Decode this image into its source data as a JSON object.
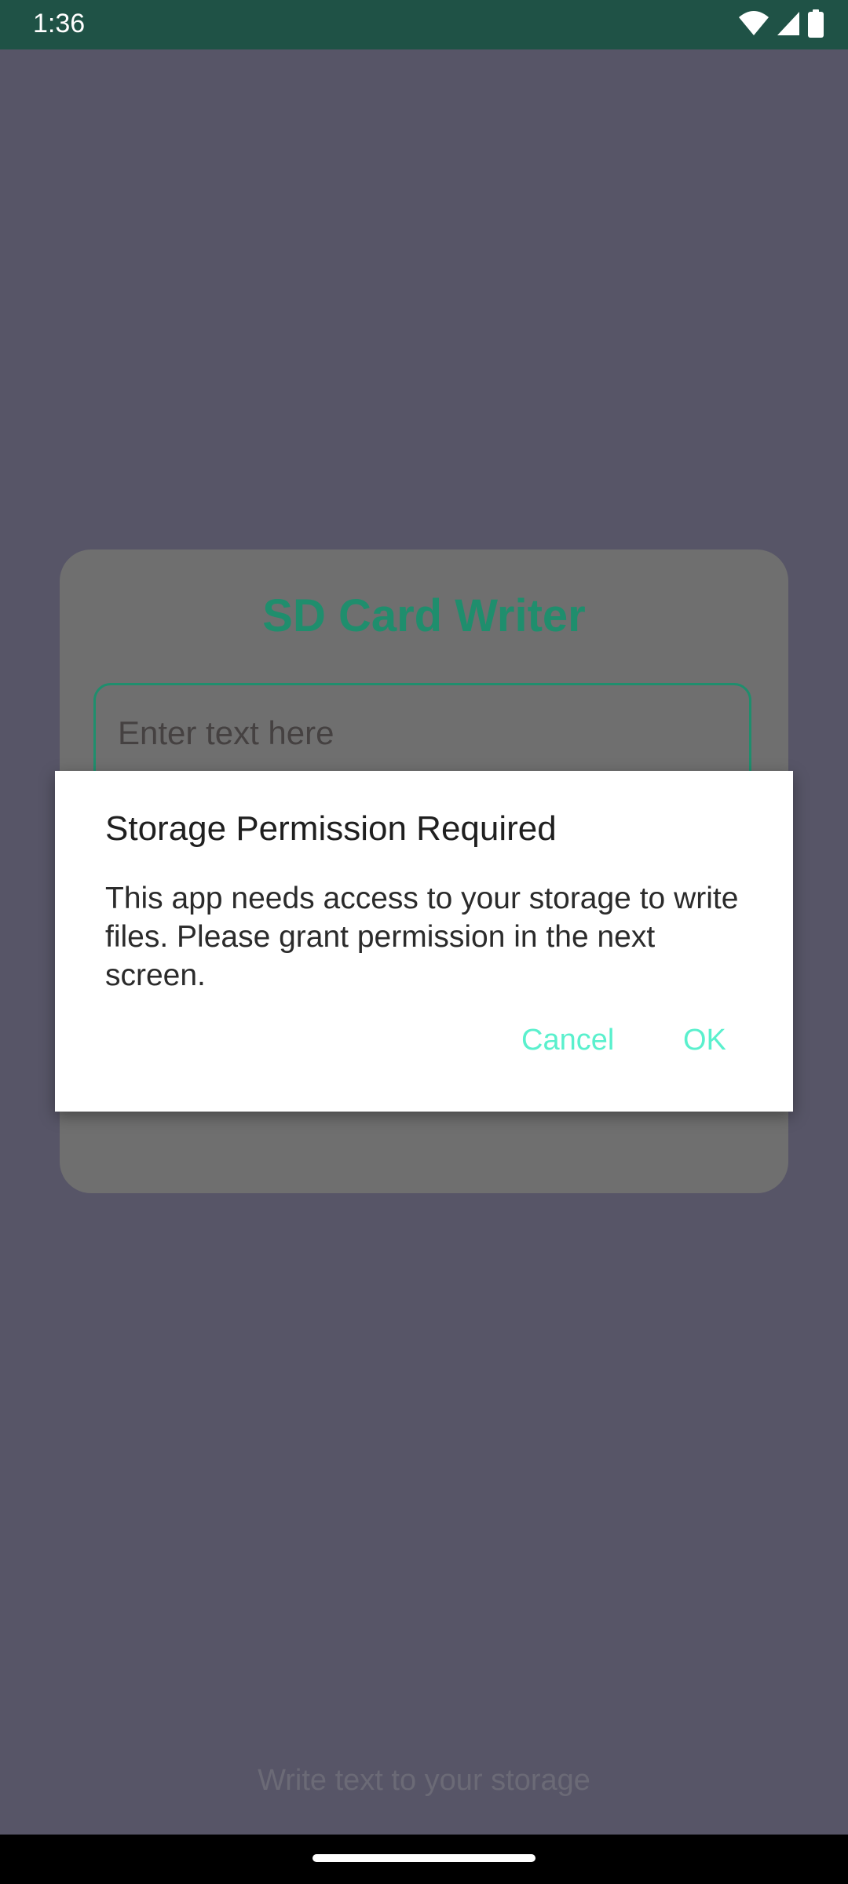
{
  "status_bar": {
    "time": "1:36",
    "icons": [
      "wifi-icon",
      "signal-icon",
      "battery-icon"
    ]
  },
  "app": {
    "title": "SD Card Writer",
    "input_placeholder": "Enter text here",
    "footer": "Write text to your storage"
  },
  "dialog": {
    "title": "Storage Permission Required",
    "message": "This app needs access to your storage to write files. Please grant permission in the next screen.",
    "cancel_label": "Cancel",
    "ok_label": "OK"
  },
  "colors": {
    "status_bar": "#1f5246",
    "accent": "#1f8e6d",
    "dialog_button": "#5af0cd",
    "scrim_background": "#575567"
  }
}
